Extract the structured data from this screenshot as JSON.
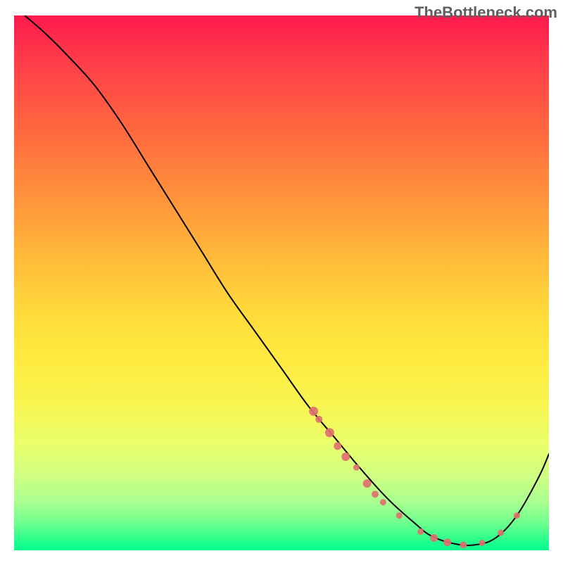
{
  "watermark": "TheBottleneck.com",
  "chart_data": {
    "type": "line",
    "title": "",
    "xlabel": "",
    "ylabel": "",
    "xlim": [
      0,
      100
    ],
    "ylim": [
      0,
      100
    ],
    "grid": false,
    "legend": false,
    "series": [
      {
        "name": "curve",
        "color": "#000000",
        "x": [
          2,
          6,
          10,
          15,
          20,
          25,
          30,
          35,
          40,
          45,
          50,
          55,
          60,
          65,
          70,
          75,
          78,
          82,
          86,
          90,
          94,
          98,
          100
        ],
        "values": [
          100,
          96.5,
          92.5,
          87,
          80,
          72,
          64,
          56,
          48,
          41,
          34,
          27,
          21,
          15,
          9.5,
          5,
          2.7,
          1.3,
          1.0,
          2.3,
          6.5,
          13.5,
          18
        ]
      }
    ],
    "highlight_points": {
      "name": "markers",
      "color": "#e07070",
      "radius_default": 6,
      "points": [
        {
          "x": 56,
          "y": 26,
          "r": 6.5
        },
        {
          "x": 57,
          "y": 24.5,
          "r": 5
        },
        {
          "x": 59,
          "y": 22,
          "r": 6.5
        },
        {
          "x": 60.5,
          "y": 19.5,
          "r": 5.5
        },
        {
          "x": 62,
          "y": 17.5,
          "r": 6
        },
        {
          "x": 64,
          "y": 15.5,
          "r": 4.5
        },
        {
          "x": 66,
          "y": 12.5,
          "r": 6
        },
        {
          "x": 67.5,
          "y": 10.5,
          "r": 5
        },
        {
          "x": 69,
          "y": 9,
          "r": 4.5
        },
        {
          "x": 72,
          "y": 6.5,
          "r": 4.5
        },
        {
          "x": 76,
          "y": 3.5,
          "r": 4.5
        },
        {
          "x": 78.5,
          "y": 2.3,
          "r": 5.5
        },
        {
          "x": 81,
          "y": 1.5,
          "r": 5.5
        },
        {
          "x": 84,
          "y": 1.0,
          "r": 5
        },
        {
          "x": 87.5,
          "y": 1.4,
          "r": 4.5
        },
        {
          "x": 91,
          "y": 3.3,
          "r": 4.5
        },
        {
          "x": 94,
          "y": 6.5,
          "r": 4.5
        }
      ]
    },
    "background_gradient": {
      "top_color": "#ff1a4e",
      "bottom_color": "#00ff90"
    }
  }
}
